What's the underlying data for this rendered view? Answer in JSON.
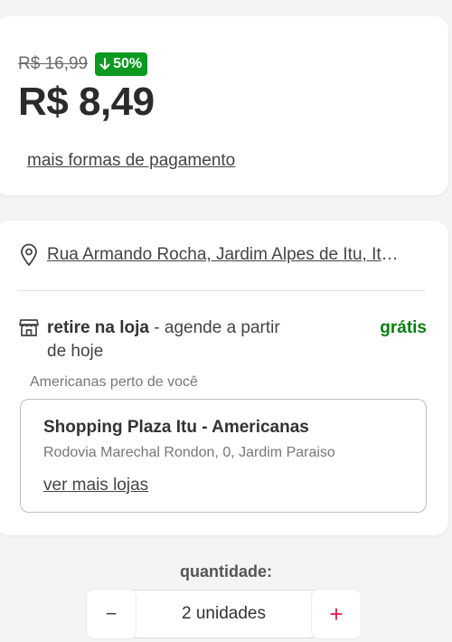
{
  "price": {
    "old_price": "R$ 16,99",
    "discount": "50%",
    "current_price": "R$ 8,49",
    "payment_link": "mais formas de pagamento"
  },
  "delivery": {
    "address": "Rua Armando Rocha, Jardim Alpes de Itu, Itu - SP",
    "pickup_title": "retire na loja",
    "pickup_desc": " - agende a partir de hoje",
    "pickup_price": "grátis",
    "near_label": "Americanas perto de você",
    "store": {
      "name": "Shopping Plaza Itu - Americanas",
      "address": "Rodovia Marechal Rondon, 0, Jardim Paraiso",
      "more_link": "ver mais lojas"
    }
  },
  "quantity": {
    "label": "quantidade:",
    "value": "2 unidades",
    "minus": "−",
    "plus": "+"
  },
  "colors": {
    "discount_bg": "#0a9a1f",
    "free_text": "#0a7d12",
    "plus_icon": "#e0234e"
  },
  "icons": {
    "discount": "arrow-down-icon",
    "address": "location-pin-icon",
    "pickup": "store-icon"
  }
}
